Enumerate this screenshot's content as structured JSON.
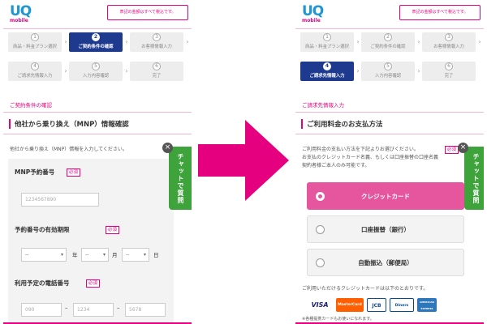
{
  "left_screen": {
    "logo": {
      "uq": "UQ",
      "mobile": "mobile"
    },
    "tax_note": "表記の金額はすべて税込です。",
    "steps": [
      {
        "num": "1",
        "label": "商品・料金プラン選択"
      },
      {
        "num": "2",
        "label": "ご契約条件の確認"
      },
      {
        "num": "3",
        "label": "お客様情報入力"
      },
      {
        "num": "4",
        "label": "ご請求先情報入力"
      },
      {
        "num": "5",
        "label": "入力内容確認"
      },
      {
        "num": "6",
        "label": "完了"
      }
    ],
    "active_step": 2,
    "breadcrumb": "ご契約条件の確認",
    "section_title": "他社から乗り換え（MNP）情報確認",
    "description": "他社から乗り換え（MNP）情報を入力してください。",
    "required_badge": "必須",
    "fields": {
      "mnp_label": "MNP予約番号",
      "mnp_placeholder": "1234567890",
      "expiry_label": "予約番号の有効期限",
      "expiry_year": "--",
      "expiry_month": "--",
      "expiry_day": "--",
      "unit_year": "年",
      "unit_month": "月",
      "unit_day": "日",
      "phone_label": "利用予定の電話番号",
      "phone_1": "090",
      "phone_2": "1234",
      "phone_3": "5678",
      "phone_sep": "–"
    },
    "chat": {
      "label": "チャットで質問",
      "close": "×"
    }
  },
  "right_screen": {
    "logo": {
      "uq": "UQ",
      "mobile": "mobile"
    },
    "tax_note": "表記の金額はすべて税込です。",
    "steps": [
      {
        "num": "1",
        "label": "商品・料金プラン選択"
      },
      {
        "num": "2",
        "label": "ご契約条件の確認"
      },
      {
        "num": "3",
        "label": "お客様情報入力"
      },
      {
        "num": "4",
        "label": "ご請求先情報入力"
      },
      {
        "num": "5",
        "label": "入力内容確認"
      },
      {
        "num": "6",
        "label": "完了"
      }
    ],
    "active_step": 4,
    "breadcrumb": "ご請求先情報入力",
    "section_title": "ご利用料金のお支払方法",
    "desc_lines": [
      "ご利用料金の支払い方法を下記よりお選びください。",
      "お支払のクレジットカード名義、もしくは口座振替の口座名義",
      "契約者様ご本人のみ可能です。"
    ],
    "required_badge": "必須",
    "payment_options": [
      {
        "label": "クレジットカード",
        "selected": true
      },
      {
        "label": "口座振替（銀行）",
        "selected": false
      },
      {
        "label": "自動振込（郵便局）",
        "selected": false
      }
    ],
    "card_note": "ご利用いただけるクレジットカードは以下のとおりです。",
    "cards": [
      "VISA",
      "MasterCard",
      "JCB",
      "Diners Club",
      "AMERICAN EXPRESS"
    ],
    "footnote": "※各種提携カードもお使いになれます。",
    "chat": {
      "label": "チャットで質問",
      "close": "×"
    }
  },
  "colors": {
    "brand_pink": "#e5007f",
    "active_step": "#1d3a8f",
    "selected_option": "#e5569e",
    "chat_green": "#3fa33c",
    "arrow": "#e5007f"
  },
  "icons": [
    "right-arrow-icon",
    "close-icon",
    "radio-icon",
    "caret-down-icon"
  ]
}
